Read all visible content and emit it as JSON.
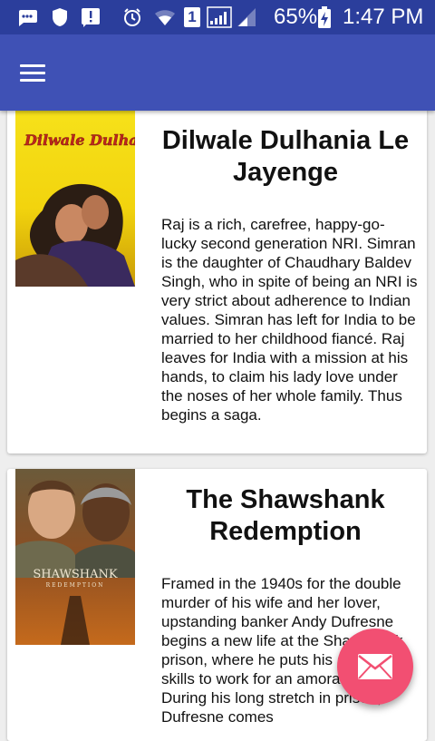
{
  "status_bar": {
    "battery_percent": "65%",
    "time": "1:47 PM",
    "sim_slot": "1",
    "icons": [
      "messages-icon",
      "shield-icon",
      "alert-icon",
      "alarm-icon",
      "wifi-icon",
      "sim-icon",
      "signal-icon",
      "signal-weak-icon",
      "battery-charging-icon"
    ]
  },
  "app_bar": {
    "color": "#3f51b5",
    "menu_icon": "hamburger-menu-icon"
  },
  "movies": [
    {
      "title": "Dilwale Dulhania Le Jayenge",
      "poster_text": "Dilwale Dulhania Le Jayenge",
      "description": "Raj is a rich, carefree, happy-go-lucky second generation NRI. Simran is the daughter of Chaudhary Baldev Singh, who in spite of being an NRI is very strict about adherence to Indian values. Simran has left for India to be married to her childhood fiancé. Raj leaves for India with a mission at his hands, to claim his lady love under the noses of her whole family. Thus begins a saga."
    },
    {
      "title": "The Shawshank Redemption",
      "poster_text": "SHAWSHANK",
      "poster_subtext": "REDEMPTION",
      "description": "Framed in the 1940s for the double murder of his wife and her lover, upstanding banker Andy Dufresne begins a new life at the Shawshank prison, where he puts his accounting skills to work for an amoral warden. During his long stretch in prison, Dufresne comes"
    }
  ],
  "fab": {
    "icon": "mail-icon",
    "color": "#f24f72"
  }
}
